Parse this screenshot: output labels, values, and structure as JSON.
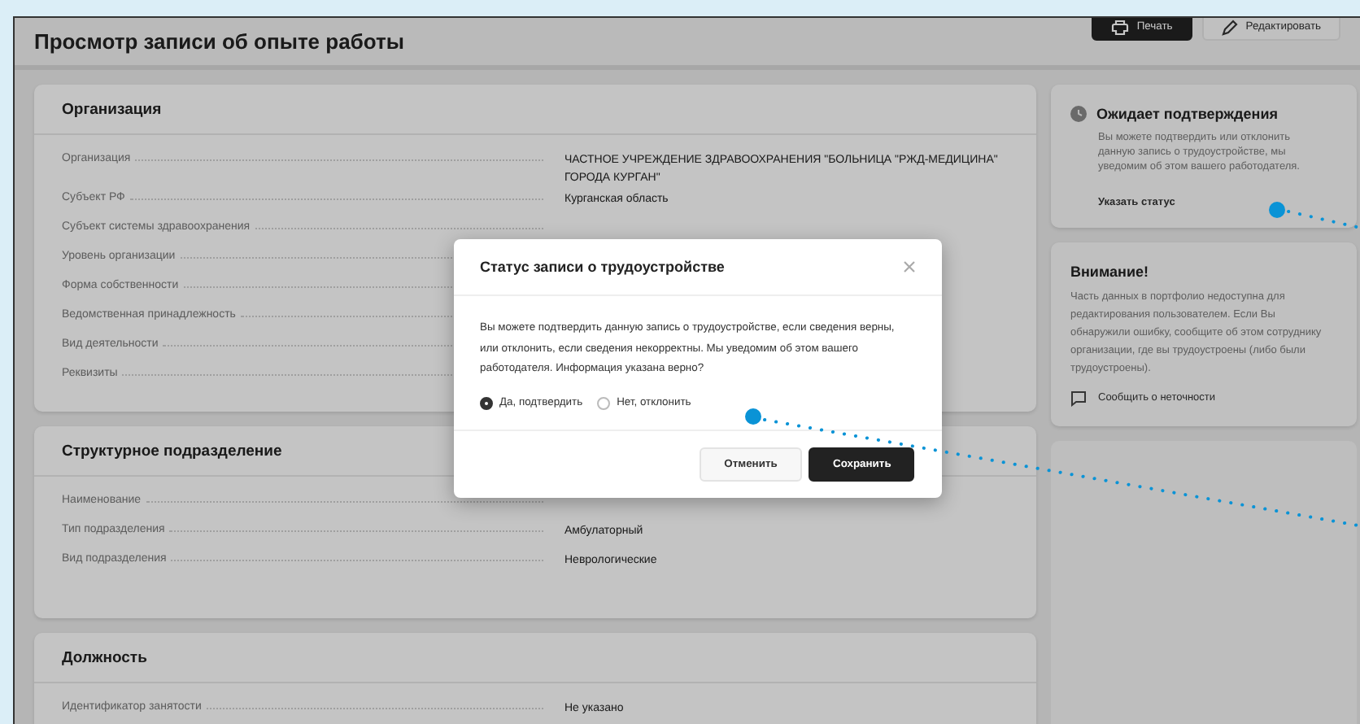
{
  "page": {
    "title": "Просмотр записи об опыте работы",
    "actions": [
      {
        "label": "Печать",
        "kind": "primary"
      },
      {
        "label": "Редактировать",
        "kind": "secondary"
      }
    ]
  },
  "sections": [
    {
      "title": "Организация",
      "rows": [
        {
          "label": "Организация",
          "value": "ЧАСТНОЕ УЧРЕЖДЕНИЕ ЗДРАВООХРАНЕНИЯ \"БОЛЬНИЦА \"РЖД-МЕДИЦИНА\" ГОРОДА КУРГАН\""
        },
        {
          "label": "Субъект РФ",
          "value": "Курганская область"
        },
        {
          "label": "Субъект системы здравоохранения"
        },
        {
          "label": "Уровень организации"
        },
        {
          "label": "Форма собственности"
        },
        {
          "label": "Ведомственная принадлежность"
        },
        {
          "label": "Вид деятельности"
        },
        {
          "label": "Реквизиты"
        }
      ]
    },
    {
      "title": "Структурное подразделение",
      "rows": [
        {
          "label": "Наименование"
        },
        {
          "label": "Тип подразделения",
          "value": "Амбулаторный"
        },
        {
          "label": "Вид подразделения",
          "value": "Неврологические"
        }
      ]
    },
    {
      "title": "Должность",
      "rows": [
        {
          "label": "Идентификатор занятости",
          "value": "Не указано"
        }
      ]
    }
  ],
  "status_card": {
    "title": "Ожидает подтверждения",
    "text": "Вы можете подтвердить или отклонить данную запись о трудоустройстве, мы уведомим об этом вашего работодателя.",
    "link": "Указать статус"
  },
  "notice_card": {
    "title": "Внимание!",
    "text": "Часть данных в портфолио недоступна для редактирования пользователем. Если Вы обнаружили ошибку, сообщите об этом сотруднику организации, где вы трудоустроены (либо были трудоустроены).",
    "link": "Сообщить о неточности"
  },
  "dialog": {
    "title": "Статус записи о трудоустройстве",
    "text": "Вы можете подтвердить данную запись о трудоустройстве, если сведения верны, или отклонить, если сведения некорректны. Мы уведомим об этом вашего работодателя. Информация указана верно?",
    "options": [
      {
        "label": "Да, подтвердить",
        "selected": true
      },
      {
        "label": "Нет, отклонить",
        "selected": false
      }
    ],
    "buttons": [
      {
        "label": "Отменить",
        "kind": "secondary"
      },
      {
        "label": "Сохранить",
        "kind": "primary"
      }
    ]
  }
}
